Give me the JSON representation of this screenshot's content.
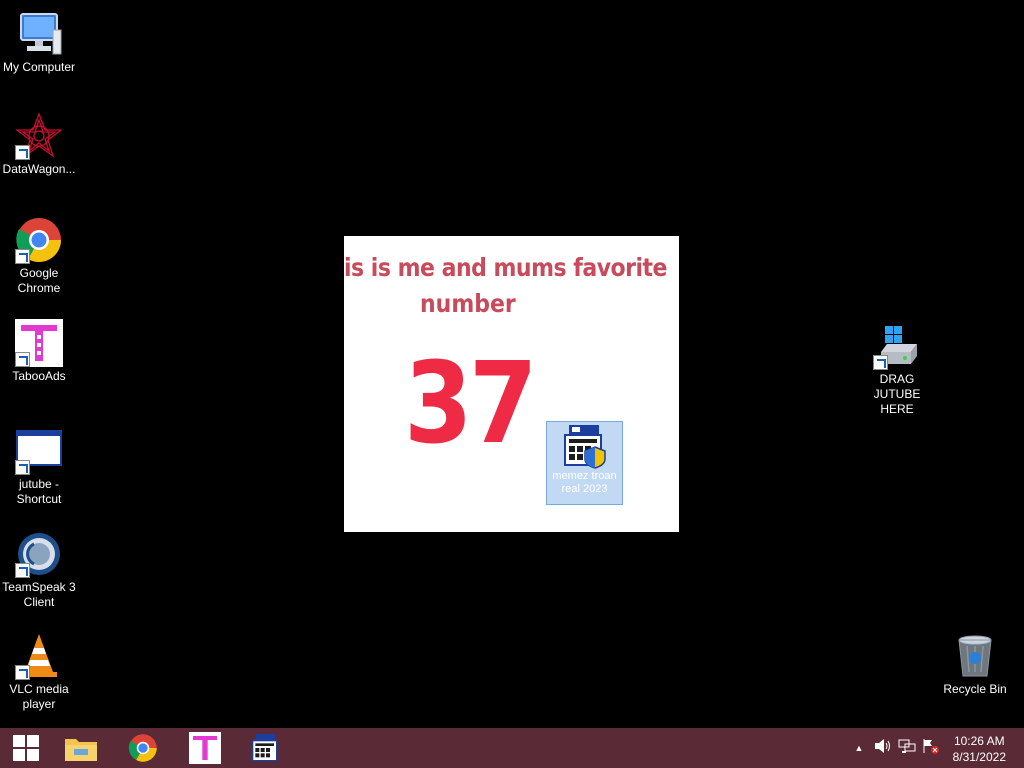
{
  "desktop": {
    "icons": [
      {
        "label": "My Computer"
      },
      {
        "label": "DataWagon..."
      },
      {
        "label": "Google Chrome"
      },
      {
        "label": "TabooAds"
      },
      {
        "label": "jutube - Shortcut"
      },
      {
        "label": "TeamSpeak 3 Client"
      },
      {
        "label": "VLC media player"
      },
      {
        "label": "DRAG JUTUBE HERE"
      },
      {
        "label": "Recycle Bin"
      }
    ]
  },
  "popup": {
    "line1": "is is me and mums favorite",
    "line2": "number",
    "number": "37",
    "selected_icon_label": "memez troan real 2023"
  },
  "taskbar": {
    "time": "10:26 AM",
    "date": "8/31/2022"
  },
  "colors": {
    "taskbar": "#5a2a36",
    "popup_text": "#c94a5a",
    "popup_number": "#ef2a45"
  }
}
